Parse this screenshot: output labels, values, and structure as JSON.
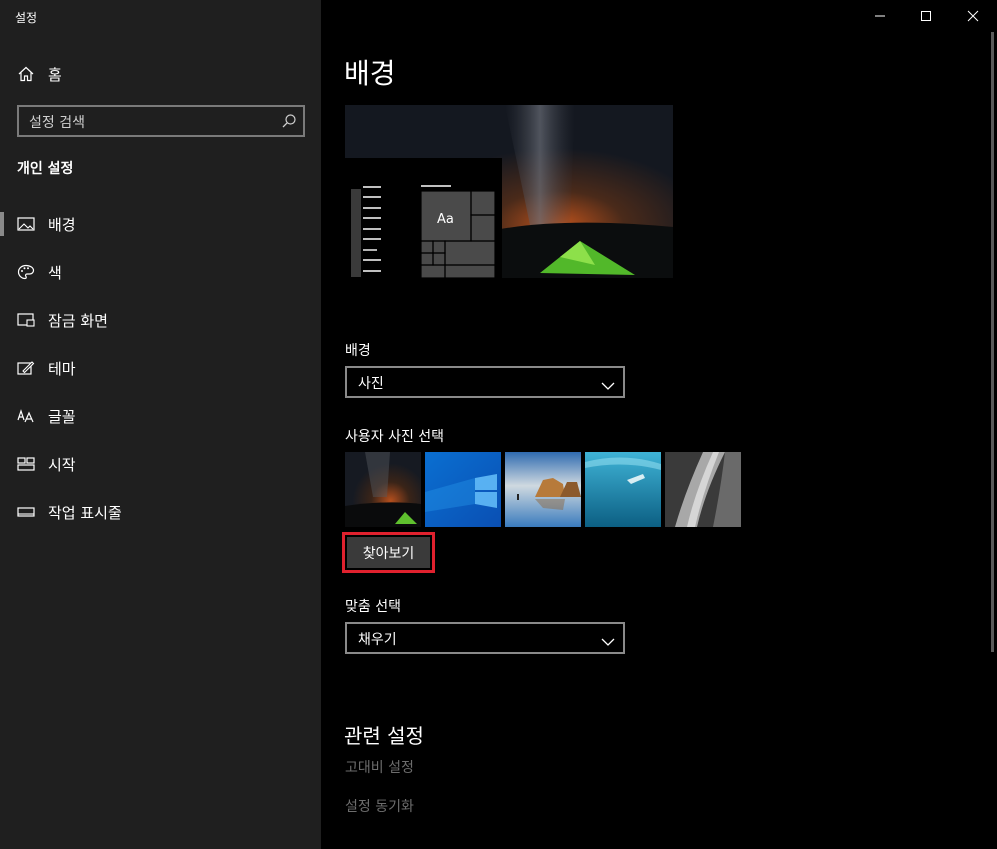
{
  "window": {
    "title": "설정",
    "controls": [
      "minimize",
      "maximize",
      "close"
    ]
  },
  "sidebar": {
    "home_label": "홈",
    "search_placeholder": "설정 검색",
    "group_title": "개인 설정",
    "items": [
      {
        "label": "배경",
        "icon": "picture-icon",
        "selected": true
      },
      {
        "label": "색",
        "icon": "palette-icon",
        "selected": false
      },
      {
        "label": "잠금 화면",
        "icon": "lock-screen-icon",
        "selected": false
      },
      {
        "label": "테마",
        "icon": "theme-brush-icon",
        "selected": false
      },
      {
        "label": "글꼴",
        "icon": "font-icon",
        "selected": false
      },
      {
        "label": "시작",
        "icon": "start-tiles-icon",
        "selected": false
      },
      {
        "label": "작업 표시줄",
        "icon": "taskbar-icon",
        "selected": false
      }
    ]
  },
  "main": {
    "page_title": "배경",
    "preview_tile_text": "Aa",
    "background_label": "배경",
    "background_value": "사진",
    "choose_photo_label": "사용자 사진 선택",
    "thumbnails": [
      "night-sky-tent",
      "windows-blue",
      "beach-rocks",
      "underwater-swimmer",
      "rock-cliff"
    ],
    "browse_button": "찾아보기",
    "fit_label": "맞춤 선택",
    "fit_value": "채우기",
    "related_title": "관련 설정",
    "related_links": [
      "고대비 설정",
      "설정 동기화"
    ]
  },
  "colors": {
    "sidebar_bg": "#1f1f1f",
    "main_bg": "#000000",
    "highlight_border": "#e0212e",
    "link_muted": "#6d6d6d"
  }
}
